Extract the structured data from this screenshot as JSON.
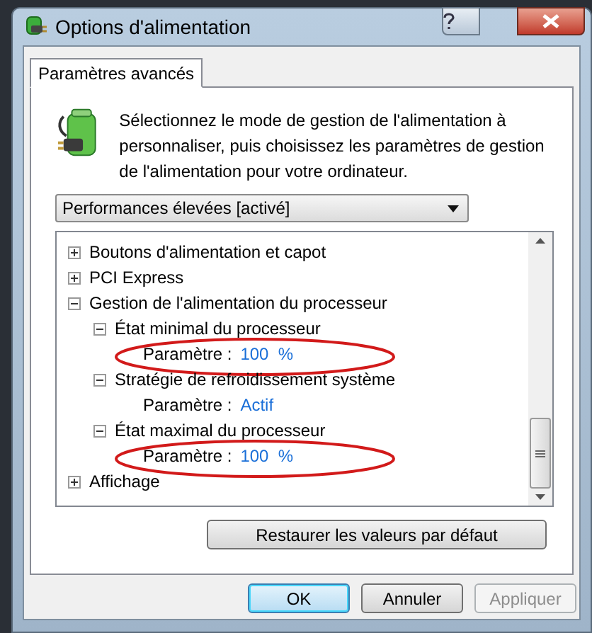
{
  "window": {
    "title": "Options d'alimentation"
  },
  "tabs": [
    {
      "label": "Paramètres avancés",
      "selected": true
    }
  ],
  "description": "Sélectionnez le mode de gestion de l'alimentation à personnaliser, puis choisissez les paramètres de gestion de l'alimentation pour votre ordinateur.",
  "plan_dropdown": {
    "value": "Performances élevées [activé]"
  },
  "tree": [
    {
      "label": "Boutons d'alimentation et capot",
      "expanded": false
    },
    {
      "label": "PCI Express",
      "expanded": false
    },
    {
      "label": "Gestion de l'alimentation du processeur",
      "expanded": true,
      "children": [
        {
          "label": "État minimal du processeur",
          "expanded": true,
          "circled": true,
          "setting": {
            "label": "Paramètre :",
            "value": "100  %"
          }
        },
        {
          "label": "Stratégie de refroidissement système",
          "expanded": true,
          "circled": false,
          "setting": {
            "label": "Paramètre :",
            "value": "Actif"
          }
        },
        {
          "label": "État maximal du processeur",
          "expanded": true,
          "circled": true,
          "setting": {
            "label": "Paramètre :",
            "value": "100  %"
          }
        }
      ]
    },
    {
      "label": "Affichage",
      "expanded": false
    }
  ],
  "restore_button": "Restaurer les valeurs par défaut",
  "buttons": [
    {
      "label": "OK",
      "kind": "default",
      "disabled": false
    },
    {
      "label": "Annuler",
      "kind": "normal",
      "disabled": false
    },
    {
      "label": "Appliquer",
      "kind": "normal",
      "disabled": true
    }
  ]
}
